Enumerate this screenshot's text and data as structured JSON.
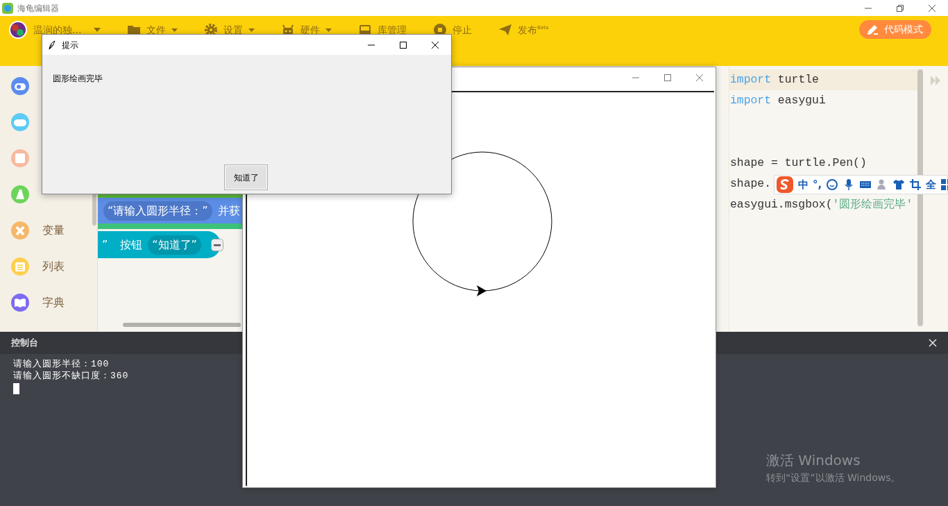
{
  "app": {
    "title": "海龟编辑器"
  },
  "toolbar": {
    "user": "温润的独...",
    "menus": [
      {
        "kind": "folder",
        "label": "文件",
        "dropdown": true
      },
      {
        "kind": "gear",
        "label": "设置",
        "dropdown": true
      },
      {
        "kind": "robot",
        "label": "硬件",
        "dropdown": true
      },
      {
        "kind": "inbox",
        "label": "库管理",
        "dropdown": false
      },
      {
        "kind": "stop",
        "label": "停止",
        "dropdown": false
      },
      {
        "kind": "send",
        "label": "发布",
        "dropdown": false,
        "badge": "Beta"
      }
    ],
    "mode_button": "代码模式"
  },
  "sidebar": {
    "categories": [
      {
        "kind": "toggle",
        "color": "#5b8cf0"
      },
      {
        "kind": "gamepad",
        "color": "#5ccbf5"
      },
      {
        "kind": "calc",
        "color": "#f7b9a0"
      },
      {
        "kind": "text",
        "color": "#6cd55a"
      },
      {
        "kind": "variable",
        "color": "#f5b86a",
        "label": "变量"
      },
      {
        "kind": "list",
        "color": "#ffcf4f",
        "label": "列表"
      },
      {
        "kind": "dict",
        "color": "#7d6cf0",
        "label": "字典"
      }
    ]
  },
  "blocks": {
    "prompt": "“请输入圆形半径：”",
    "after": "并获",
    "quote": "”",
    "button_label": "按钮",
    "button_text": "“知道了”"
  },
  "code": {
    "lines": [
      {
        "kind": "code",
        "active": true,
        "segments": [
          {
            "kind": "keyword",
            "text": "import"
          },
          {
            "kind": "plain",
            "text": " turtle"
          }
        ]
      },
      {
        "kind": "code",
        "active": false,
        "segments": [
          {
            "kind": "keyword",
            "text": "import"
          },
          {
            "kind": "plain",
            "text": " easygui"
          }
        ]
      },
      {
        "kind": "blank"
      },
      {
        "kind": "blank"
      },
      {
        "kind": "code",
        "active": false,
        "segments": [
          {
            "kind": "plain",
            "text": "shape = turtle.Pen()"
          }
        ]
      },
      {
        "kind": "code",
        "active": false,
        "segments": [
          {
            "kind": "plain",
            "text": "shape."
          }
        ]
      },
      {
        "kind": "code",
        "active": false,
        "segments": [
          {
            "kind": "plain",
            "text": "easygui.msgbox("
          },
          {
            "kind": "string",
            "text": "'圆形绘画完毕'"
          }
        ]
      }
    ]
  },
  "console": {
    "title": "控制台",
    "lines": [
      {
        "prompt": "请输入圆形半径：",
        "value": "100"
      },
      {
        "prompt": "请输入圆形不缺口度：",
        "value": "360"
      }
    ]
  },
  "dialog": {
    "title": "提示",
    "message": "圆形绘画完毕",
    "button": "知道了"
  },
  "ime": {
    "items": [
      {
        "kind": "text",
        "text": "中"
      },
      {
        "kind": "text",
        "text": "°,"
      },
      {
        "kind": "smiley"
      },
      {
        "kind": "mic"
      },
      {
        "kind": "keyboard"
      },
      {
        "kind": "person"
      },
      {
        "kind": "shirt"
      },
      {
        "kind": "crop"
      },
      {
        "kind": "text",
        "text": "全"
      },
      {
        "kind": "grid"
      }
    ]
  },
  "activation": {
    "title": "激活 Windows",
    "subtitle": "转到“设置”以激活 Windows。"
  }
}
